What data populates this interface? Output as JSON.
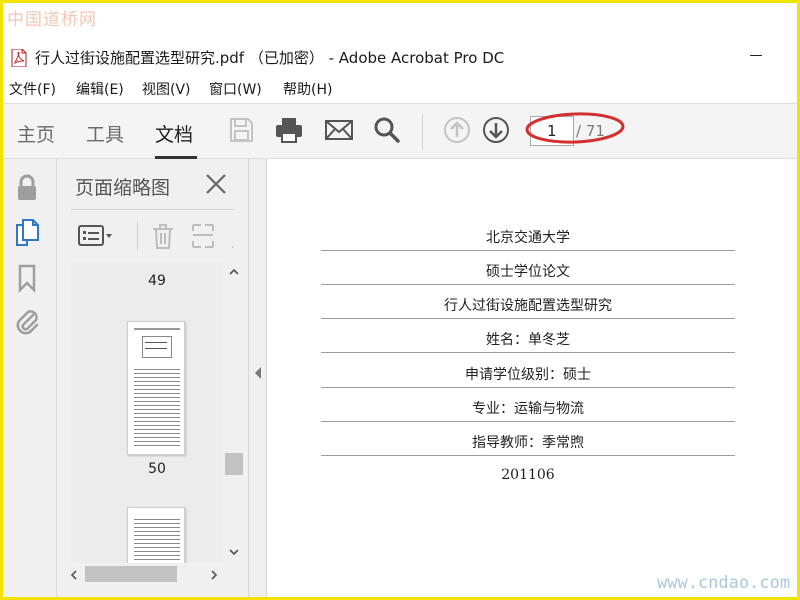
{
  "watermarks": {
    "top": "中国道桥网",
    "bottom": "www.cndao.com"
  },
  "window": {
    "title": "行人过街设施配置选型研究.pdf （已加密） - Adobe Acrobat Pro DC"
  },
  "menu": [
    "文件(F)",
    "编辑(E)",
    "视图(V)",
    "窗口(W)",
    "帮助(H)"
  ],
  "toolbar": {
    "tabs": [
      "主页",
      "工具",
      "文档"
    ],
    "active_tab": "文档",
    "icons": [
      "save-icon",
      "print-icon",
      "email-icon",
      "search-icon",
      "page-up-icon",
      "page-down-icon"
    ],
    "current_page": "1",
    "total_pages": "/ 71",
    "highlight_color": "#d32f2f"
  },
  "left_rail": {
    "icons": [
      "lock-icon",
      "pages-icon",
      "bookmark-icon",
      "attachment-icon"
    ],
    "active_color": "#2d78c8"
  },
  "panel": {
    "title": "页面缩略图",
    "thumbnails": [
      {
        "page": "49"
      },
      {
        "page": "50"
      }
    ]
  },
  "document": {
    "rows": [
      "北京交通大学",
      "硕士学位论文",
      "行人过街设施配置选型研究",
      "姓名：单冬芝",
      "申请学位级别：硕士",
      "专业：运输与物流",
      "指导教师：季常煦",
      "201106"
    ]
  }
}
